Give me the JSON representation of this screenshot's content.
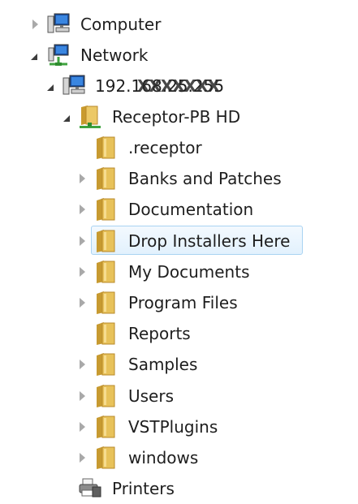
{
  "tree": {
    "computer": {
      "label": "Computer",
      "icon": "computer-icon",
      "state": "collapsed"
    },
    "network": {
      "label": "Network",
      "icon": "network-icon",
      "state": "expanded"
    },
    "host": {
      "label": "192.168.25.255",
      "overlay": "XXXXXXX",
      "icon": "computer-icon",
      "state": "expanded"
    },
    "share": {
      "label": "Receptor-PB HD",
      "icon": "shared-folder-icon",
      "state": "expanded"
    },
    "folders": [
      {
        "label": ".receptor",
        "state": "none"
      },
      {
        "label": "Banks and Patches",
        "state": "collapsed"
      },
      {
        "label": "Documentation",
        "state": "collapsed"
      },
      {
        "label": "Drop Installers Here",
        "state": "collapsed",
        "selected": true
      },
      {
        "label": "My Documents",
        "state": "collapsed"
      },
      {
        "label": "Program Files",
        "state": "collapsed"
      },
      {
        "label": "Reports",
        "state": "none"
      },
      {
        "label": "Samples",
        "state": "collapsed"
      },
      {
        "label": "Users",
        "state": "collapsed"
      },
      {
        "label": "VSTPlugins",
        "state": "collapsed"
      },
      {
        "label": "windows",
        "state": "collapsed"
      }
    ],
    "printers": {
      "label": "Printers",
      "icon": "printer-icon",
      "state": "none"
    }
  },
  "colors": {
    "selection_border": "#a9d3f2",
    "folder": "#e8c25a",
    "text": "#1e1e1e"
  }
}
